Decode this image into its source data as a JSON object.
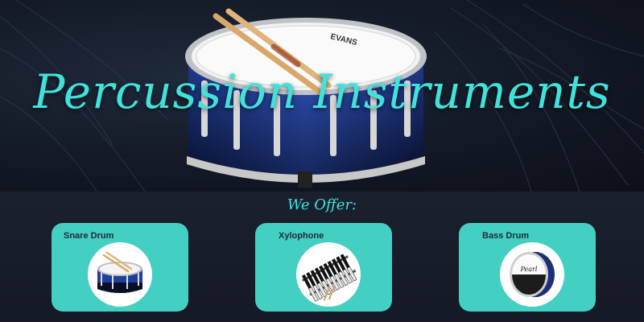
{
  "hero": {
    "title": "Percussion Instruments",
    "drumhead_brand": "EVANS"
  },
  "section": {
    "heading": "We Offer:"
  },
  "cards": [
    {
      "label": "Snare Drum",
      "icon": "snare-drum-image"
    },
    {
      "label": "Xylophone",
      "icon": "xylophone-image"
    },
    {
      "label": "Bass Drum",
      "icon": "bass-drum-image",
      "badge": "Pearl"
    }
  ],
  "colors": {
    "accent": "#3fe3dc",
    "card": "#44cfc3",
    "background": "#161b25"
  }
}
